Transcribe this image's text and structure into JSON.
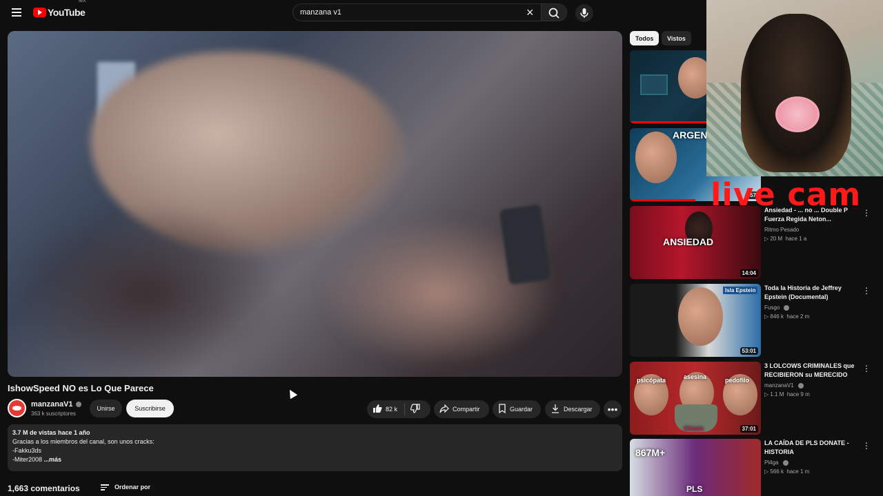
{
  "header": {
    "logo_text": "YouTube",
    "country_code": "MX",
    "search_value": "manzana v1"
  },
  "video": {
    "title": "IshowSpeed NO es Lo Que Parece",
    "channel": {
      "name": "manzanaV1",
      "subscribers": "363 k suscriptores",
      "join_label": "Unirse",
      "subscribe_label": "Suscribirse"
    },
    "actions": {
      "likes": "82 k",
      "share_label": "Compartir",
      "save_label": "Guardar",
      "download_label": "Descargar"
    },
    "description": {
      "stats": "3.7 M de vistas  hace 1 año",
      "line1": "Gracias a los miembros del canal, son unos cracks:",
      "line2": "-Fakku3ds",
      "line3": "-Miter2008",
      "more_label": "...más"
    }
  },
  "comments": {
    "count": "1,663 comentarios",
    "sort_label": "Ordenar por"
  },
  "filters": {
    "all_label": "Todos",
    "watched_label": "Vistos"
  },
  "recommendations": [
    {
      "title": "",
      "channel": "",
      "views": "",
      "age": "",
      "duration": ""
    },
    {
      "title": "",
      "channel": "",
      "views": "",
      "age": "",
      "duration": "57"
    },
    {
      "title": "Ansiedad - ... no ... Double P Fuerza Regida Neton...",
      "channel": "Ritmo Pesado",
      "views": "20 M",
      "age": "hace 1 a",
      "duration": "14:04",
      "thumb_text": "ANSIEDAD"
    },
    {
      "title": "Toda la Historia de Jeffrey Epstein (Documental)",
      "channel": "Fusgo",
      "views": "846 k",
      "age": "hace 2 m",
      "duration": "53:01",
      "thumb_text": "Isla Epstein"
    },
    {
      "title": "3 LOLCOWS CRIMINALES que RECIBIERON su MERECIDO",
      "channel": "manzanaV1",
      "views": "1.1 M",
      "age": "hace 9 m",
      "duration": "37:01",
      "thumb_text_1": "psicópata",
      "thumb_text_2": "asesina",
      "thumb_text_3": "pedofilo",
      "thumb_text_4": "Chiwis"
    },
    {
      "title": "LA CAÍDA DE PLS DONATE - HISTORIA",
      "channel": "Pl4ga",
      "views": "566 k",
      "age": "hace 1 m",
      "duration": "",
      "thumb_text_1": "867M+",
      "thumb_text_2": "PLS"
    }
  ],
  "thumb2_text": "ARGEN",
  "overlay": {
    "live_cam_text": "live cam"
  },
  "colors": {
    "background": "#0f0f0f",
    "brand_red": "#ff0000",
    "overlay_red": "#ff1a1a"
  }
}
